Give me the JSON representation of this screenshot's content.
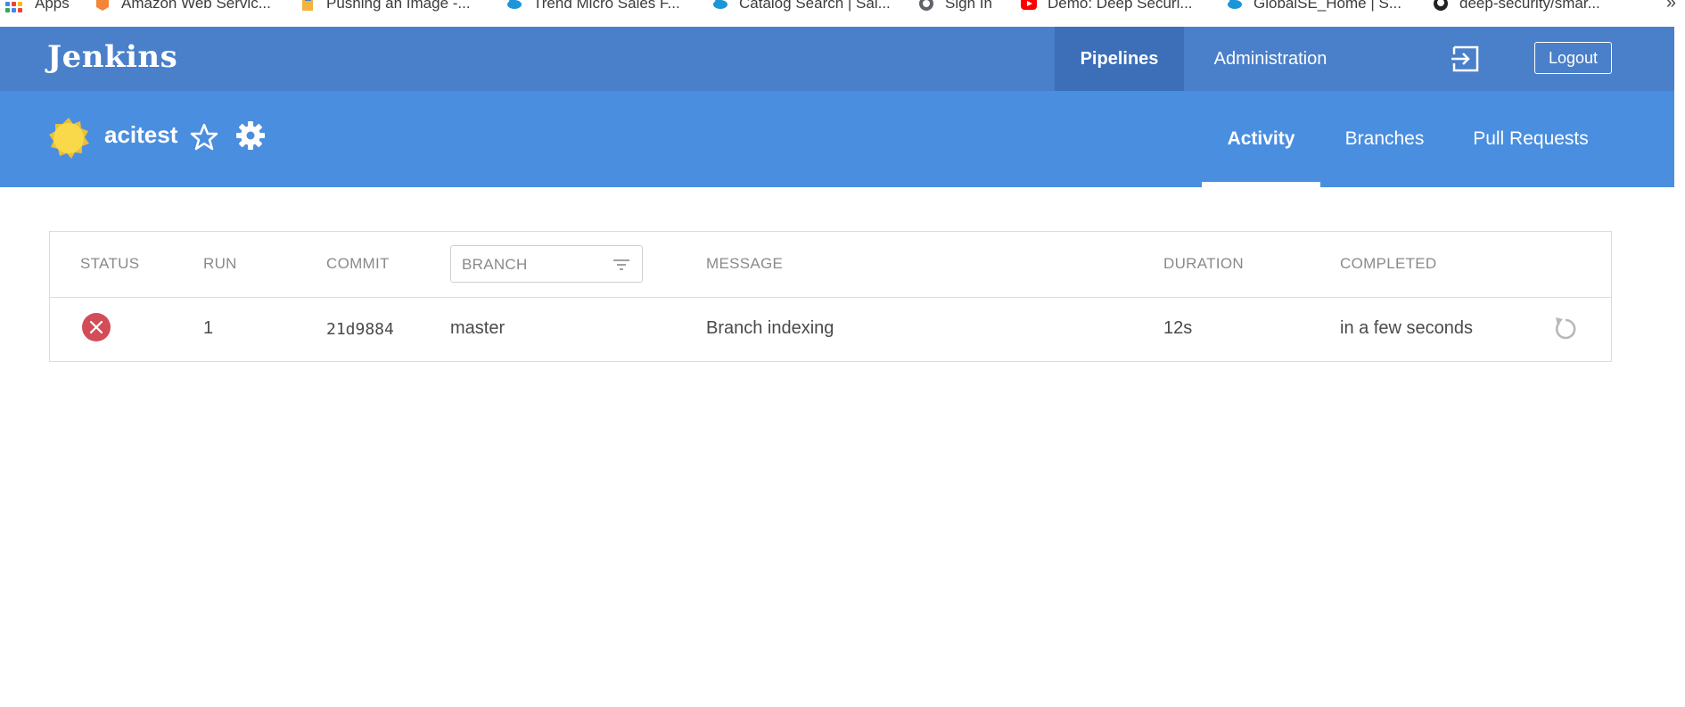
{
  "bookmarks": {
    "items": [
      {
        "label": "Apps",
        "icon": "apps-grid-icon"
      },
      {
        "label": "Amazon Web Servic...",
        "icon": "aws-icon"
      },
      {
        "label": "Pushing an Image -...",
        "icon": "doc-icon"
      },
      {
        "label": "Trend Micro Sales F...",
        "icon": "cloud-icon"
      },
      {
        "label": "Catalog Search | Sal...",
        "icon": "cloud-icon"
      },
      {
        "label": "Sign In",
        "icon": "globe-icon"
      },
      {
        "label": "Demo: Deep Securi...",
        "icon": "youtube-icon"
      },
      {
        "label": "GlobalSE_Home | S...",
        "icon": "cloud-icon"
      },
      {
        "label": "deep-security/smar...",
        "icon": "github-icon"
      }
    ],
    "overflow": "»"
  },
  "header": {
    "logo": "Jenkins",
    "nav": {
      "pipelines": "Pipelines",
      "administration": "Administration"
    },
    "logout": "Logout"
  },
  "pipeline": {
    "name": "acitest",
    "tabs": {
      "activity": "Activity",
      "branches": "Branches",
      "pull_requests": "Pull Requests"
    }
  },
  "table": {
    "headers": {
      "status": "STATUS",
      "run": "RUN",
      "commit": "COMMIT",
      "branch": "BRANCH",
      "message": "MESSAGE",
      "duration": "DURATION",
      "completed": "COMPLETED"
    },
    "rows": [
      {
        "status": "failed",
        "run": "1",
        "commit": "21d9884",
        "branch": "master",
        "message": "Branch indexing",
        "duration": "12s",
        "completed": "in a few seconds"
      }
    ]
  },
  "colors": {
    "header_bg": "#4a7fc9",
    "header_active": "#3c6fb8",
    "subheader_bg": "#4a8ee0",
    "failed": "#d24d57",
    "sunny": "#f9d949"
  }
}
